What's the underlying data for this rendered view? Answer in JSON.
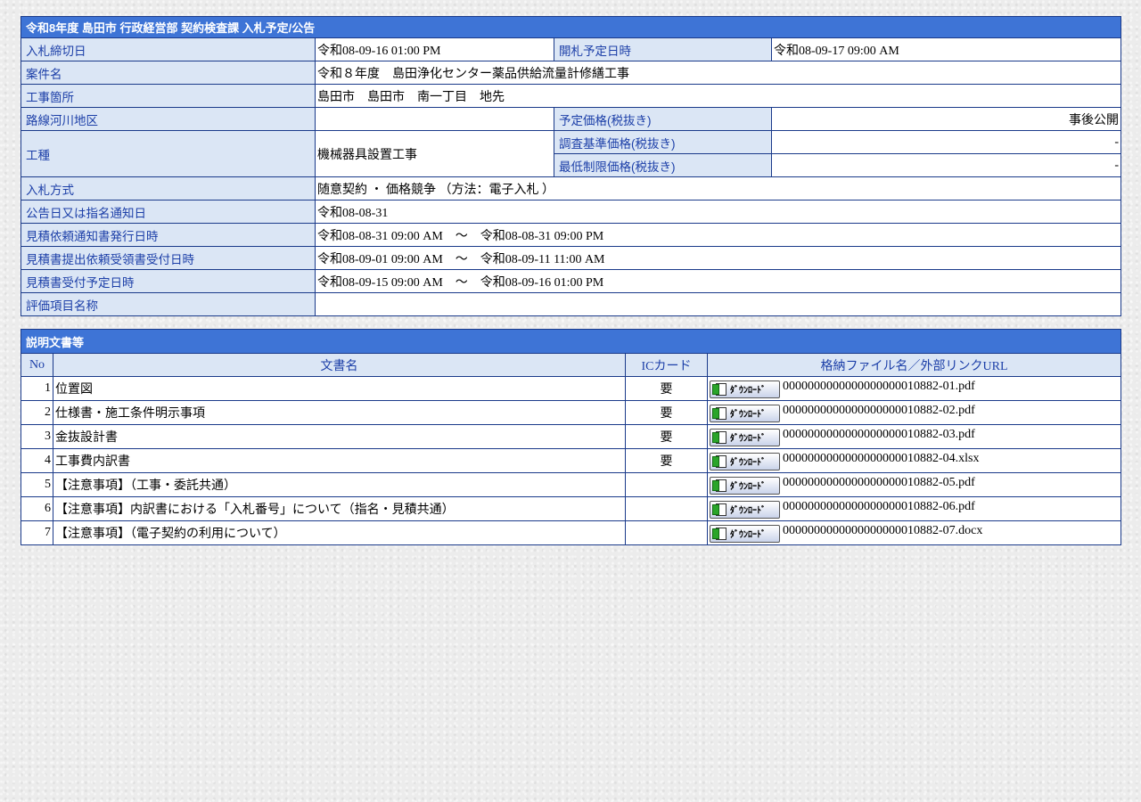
{
  "notice": {
    "title": "令和8年度 島田市 行政経営部 契約検査課 入札予定/公告",
    "rows": {
      "deadline_label": "入札締切日",
      "deadline_value": "令和08-09-16 01:00 PM",
      "opening_label": "開札予定日時",
      "opening_value": "令和08-09-17 09:00 AM",
      "case_label": "案件名",
      "case_value": "令和８年度　島田浄化センター薬品供給流量計修繕工事",
      "location_label": "工事箇所",
      "location_value": "島田市　島田市　南一丁目　地先",
      "route_label": "路線河川地区",
      "route_value": "",
      "planned_price_label": "予定価格(税抜き)",
      "planned_price_value": "事後公開",
      "work_type_label": "工種",
      "work_type_value": "機械器具設置工事",
      "survey_price_label": "調査基準価格(税抜き)",
      "survey_price_value": "-",
      "min_price_label": "最低制限価格(税抜き)",
      "min_price_value": "-",
      "method_label": "入札方式",
      "method_value": "随意契約 ・ 価格競争 （方法：電子入札 ）",
      "announce_label": "公告日又は指名通知日",
      "announce_value": "令和08-08-31",
      "estimate_notice_label": "見積依頼通知書発行日時",
      "estimate_notice_value": "令和08-08-31 09:00 AM　～　令和08-08-31 09:00 PM",
      "estimate_request_label": "見積書提出依頼受領書受付日時",
      "estimate_request_value": "令和08-09-01 09:00 AM　～　令和08-09-11 11:00 AM",
      "estimate_receipt_label": "見積書受付予定日時",
      "estimate_receipt_value": "令和08-09-15 09:00 AM　～　令和08-09-16 01:00 PM",
      "evaluation_label": "評価項目名称",
      "evaluation_value": ""
    }
  },
  "documents": {
    "title": "説明文書等",
    "headers": {
      "no": "No",
      "name": "文書名",
      "ic": "ICカード",
      "file": "格納ファイル名／外部リンクURL"
    },
    "download_label": "ﾀﾞｳﾝﾛｰﾄﾞ",
    "items": [
      {
        "no": "1",
        "name": "位置図",
        "ic": "要",
        "file": "0000000000000000000010882-01.pdf"
      },
      {
        "no": "2",
        "name": "仕様書・施工条件明示事項",
        "ic": "要",
        "file": "0000000000000000000010882-02.pdf"
      },
      {
        "no": "3",
        "name": "金抜設計書",
        "ic": "要",
        "file": "0000000000000000000010882-03.pdf"
      },
      {
        "no": "4",
        "name": "工事費内訳書",
        "ic": "要",
        "file": "0000000000000000000010882-04.xlsx"
      },
      {
        "no": "5",
        "name": "【注意事項】（工事・委託共通）",
        "ic": "",
        "file": "0000000000000000000010882-05.pdf"
      },
      {
        "no": "6",
        "name": "【注意事項】内訳書における「入札番号」について（指名・見積共通）",
        "ic": "",
        "file": "0000000000000000000010882-06.pdf"
      },
      {
        "no": "7",
        "name": "【注意事項】（電子契約の利用について）",
        "ic": "",
        "file": "0000000000000000000010882-07.docx"
      }
    ]
  }
}
